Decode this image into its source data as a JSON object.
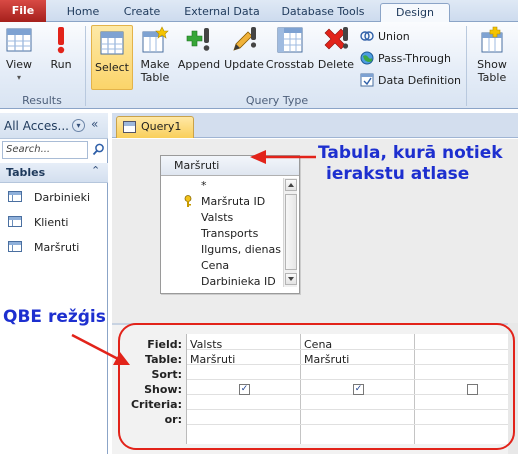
{
  "tabs": {
    "file": "File",
    "home": "Home",
    "create": "Create",
    "external_data": "External Data",
    "database_tools": "Database Tools",
    "design": "Design"
  },
  "ribbon": {
    "view": "View",
    "run": "Run",
    "select": "Select",
    "make_table_1": "Make",
    "make_table_2": "Table",
    "append": "Append",
    "update": "Update",
    "crosstab": "Crosstab",
    "delete": "Delete",
    "union": "Union",
    "pass_through": "Pass-Through",
    "data_definition": "Data Definition",
    "show_table_1": "Show",
    "show_table_2": "Table",
    "group_results": "Results",
    "group_query_type": "Query Type"
  },
  "nav": {
    "title": "All Acces...",
    "search_placeholder": "Search...",
    "group": "Tables",
    "items": [
      "Darbinieki",
      "Klienti",
      "Maršruti"
    ]
  },
  "doc": {
    "tab_label": "Query1"
  },
  "fieldlist": {
    "title": "Maršruti",
    "fields": [
      "*",
      "Maršruta ID",
      "Valsts",
      "Transports",
      "Ilgums, dienas",
      "Cena",
      "Darbinieka ID"
    ]
  },
  "qbe": {
    "row_labels": [
      "Field:",
      "Table:",
      "Sort:",
      "Show:",
      "Criteria:",
      "or:"
    ],
    "columns": [
      {
        "field": "Valsts",
        "table": "Maršruti",
        "show": true
      },
      {
        "field": "Cena",
        "table": "Maršruti",
        "show": true
      },
      {
        "field": "",
        "table": "",
        "show": false
      }
    ]
  },
  "annotations": {
    "tabula_line1": "Tabula, kurā notiek",
    "tabula_line2": "ierakstu atlase",
    "qbe": "QBE režģis"
  },
  "colors": {
    "annotation_text": "#1d2fcf",
    "annotation_arrow": "#e2231a",
    "file_tab": "#c0302b"
  }
}
